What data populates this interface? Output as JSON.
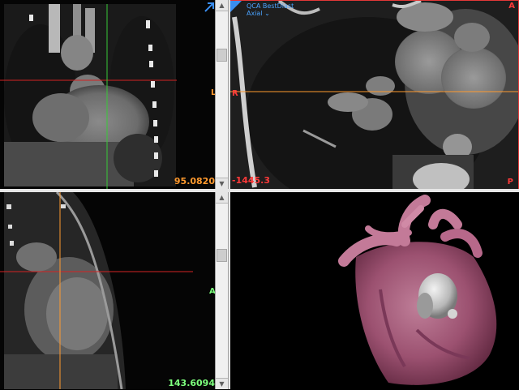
{
  "viewports": {
    "coronal": {
      "value": "95.0820",
      "orient_left": "L",
      "colors": {
        "value": "#ff9a2e",
        "orient": "#ff9a2e",
        "h_line": "#d32222",
        "v_line": "#38c838"
      }
    },
    "axial": {
      "title_line1": "QCA BestDiast",
      "title_line2": "Axial",
      "chevron": "⌄",
      "value": "-1445.3",
      "orient_top": "A",
      "orient_left": "R",
      "orient_bottom": "P",
      "colors": {
        "value": "#ff3a3a",
        "orient": "#ff3a3a",
        "border": "#e23838",
        "h_line": "#ff9a2e",
        "title": "#4aa3ff"
      }
    },
    "sagittal": {
      "value": "143.6094",
      "orient_right": "A",
      "colors": {
        "value": "#7dff7d",
        "orient": "#7dff7d",
        "h_line": "#d32222",
        "v_line": "#ff9a2e"
      }
    },
    "volume_3d": {
      "colors": {
        "vessels": "#c37a98",
        "calcium": "#cfcfcf"
      }
    }
  },
  "icons": {
    "expand_coronal": "expand-arrow-icon",
    "expand_axial": "corner-triangle-icon"
  },
  "scrollbars": {
    "top_arrow": "▲",
    "bottom_arrow": "▼"
  },
  "colors": {
    "frame_border": "#ffffff",
    "divider": "#e0e0e0",
    "accent_blue": "#3a8ef0"
  }
}
